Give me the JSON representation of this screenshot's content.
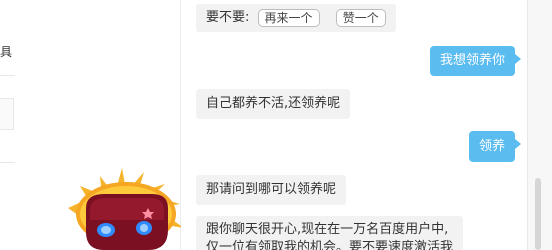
{
  "left_panel": {
    "label": "具"
  },
  "chat": {
    "messages": [
      {
        "from": "bot",
        "prompt": "要不要:",
        "options": [
          {
            "label": "再来一个"
          },
          {
            "label": "赞一个"
          }
        ]
      },
      {
        "from": "user",
        "text": "我想领养你"
      },
      {
        "from": "bot",
        "text": "自己都养不活,还领养呢"
      },
      {
        "from": "user",
        "text": "领养"
      },
      {
        "from": "bot",
        "text": "那请问到哪可以领养呢"
      },
      {
        "from": "bot",
        "lines": [
          "跟你聊天很开心,现在在一万名百度用户中,",
          "仅一位有领取我的机会。要不要速度激活我"
        ]
      }
    ]
  },
  "colors": {
    "user_bubble": "#5bbcf0",
    "bot_bubble": "#f2f2f2",
    "mascot_flame": "#f5a623",
    "mascot_body": "#8a1528"
  },
  "icons": {
    "mascot": "robot-mascot-icon"
  }
}
